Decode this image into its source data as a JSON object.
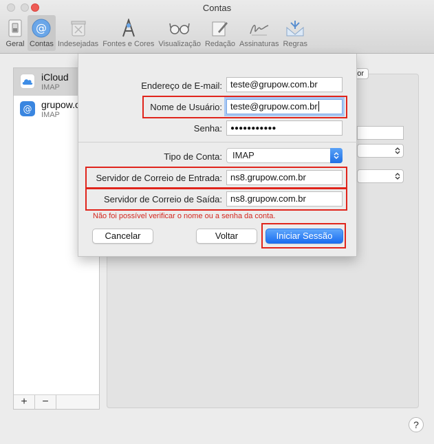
{
  "window": {
    "title": "Contas"
  },
  "toolbar": {
    "items": [
      {
        "label": "Geral",
        "icon": "switch-icon"
      },
      {
        "label": "Contas",
        "icon": "at-icon"
      },
      {
        "label": "Indesejadas",
        "icon": "trash-icon"
      },
      {
        "label": "Fontes e Cores",
        "icon": "font-icon"
      },
      {
        "label": "Visualização",
        "icon": "glasses-icon"
      },
      {
        "label": "Redação",
        "icon": "pencil-icon"
      },
      {
        "label": "Assinaturas",
        "icon": "signature-icon"
      },
      {
        "label": "Regras",
        "icon": "rules-icon"
      }
    ],
    "active": "Contas"
  },
  "sidebar": {
    "accounts": [
      {
        "name": "iCloud",
        "type": "IMAP",
        "icon": "cloud-icon"
      },
      {
        "name": "grupow.c",
        "type": "IMAP",
        "icon": "at-icon"
      }
    ],
    "add_label": "+",
    "remove_label": "−"
  },
  "background": {
    "partial_button": "or"
  },
  "help": {
    "label": "?"
  },
  "sheet": {
    "email_label": "Endereço de E-mail:",
    "email_value": "teste@grupow.com.br",
    "username_label": "Nome de Usuário:",
    "username_value": "teste@grupow.com.br",
    "password_label": "Senha:",
    "password_value": "●●●●●●●●●●●",
    "account_type_label": "Tipo de Conta:",
    "account_type_value": "IMAP",
    "incoming_label": "Servidor de Correio de Entrada:",
    "incoming_value": "ns8.grupow.com.br",
    "outgoing_label": "Servidor de Correio de Saída:",
    "outgoing_value": "ns8.grupow.com.br",
    "error_text": "Não foi possível verificar o nome ou a senha da conta.",
    "cancel_label": "Cancelar",
    "back_label": "Voltar",
    "signin_label": "Iniciar Sessão"
  },
  "colors": {
    "highlight": "#e0241b",
    "error": "#d3261e",
    "accent": "#1a6df0"
  }
}
